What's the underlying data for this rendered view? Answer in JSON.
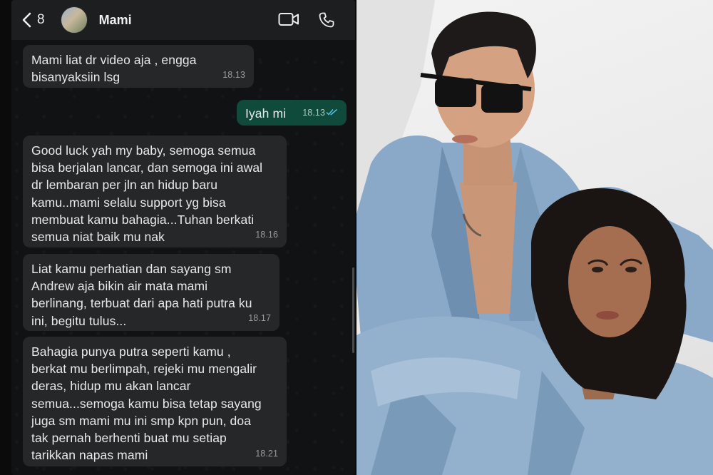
{
  "header": {
    "back_count": "8",
    "contact_name": "Mami"
  },
  "messages": [
    {
      "direction": "in",
      "text": "Mami liat dr video aja , engga\nbisanyaksiin lsg",
      "time": "18.13"
    },
    {
      "direction": "out",
      "text": "Iyah mi",
      "time": "18.13",
      "status": "read"
    },
    {
      "direction": "in",
      "text": "Good luck yah my baby, semoga semua\nbisa berjalan lancar, dan semoga ini awal\ndr lembaran per jln an hidup baru\nkamu..mami selalu support yg bisa\nmembuat kamu bahagia...Tuhan berkati\nsemua niat baik mu nak",
      "time": "18.16"
    },
    {
      "direction": "in",
      "text": "Liat kamu perhatian dan sayang sm\nAndrew aja bikin air mata mami\nberlinang, terbuat dari apa hati putra ku\nini, begitu tulus...",
      "time": "18.17"
    },
    {
      "direction": "in",
      "text": "Bahagia punya putra seperti kamu ,\nberkat mu berlimpah, rejeki mu mengalir\nderas, hidup mu akan lancar\nsemua...semoga kamu bisa tetap sayang\njuga sm mami mu ini smp kpn pun, doa\ntak pernah berhenti buat mu setiap\ntarikkan napas mami",
      "time": "18.21"
    }
  ],
  "icons": {
    "back": "chevron-left-icon",
    "video": "video-call-icon",
    "phone": "phone-icon",
    "read": "double-check-icon"
  },
  "colors": {
    "incoming_bubble": "#262728",
    "outgoing_bubble": "#0f4a3b",
    "read_ticks": "#53bdeb",
    "denim": "#8aa9c8"
  }
}
